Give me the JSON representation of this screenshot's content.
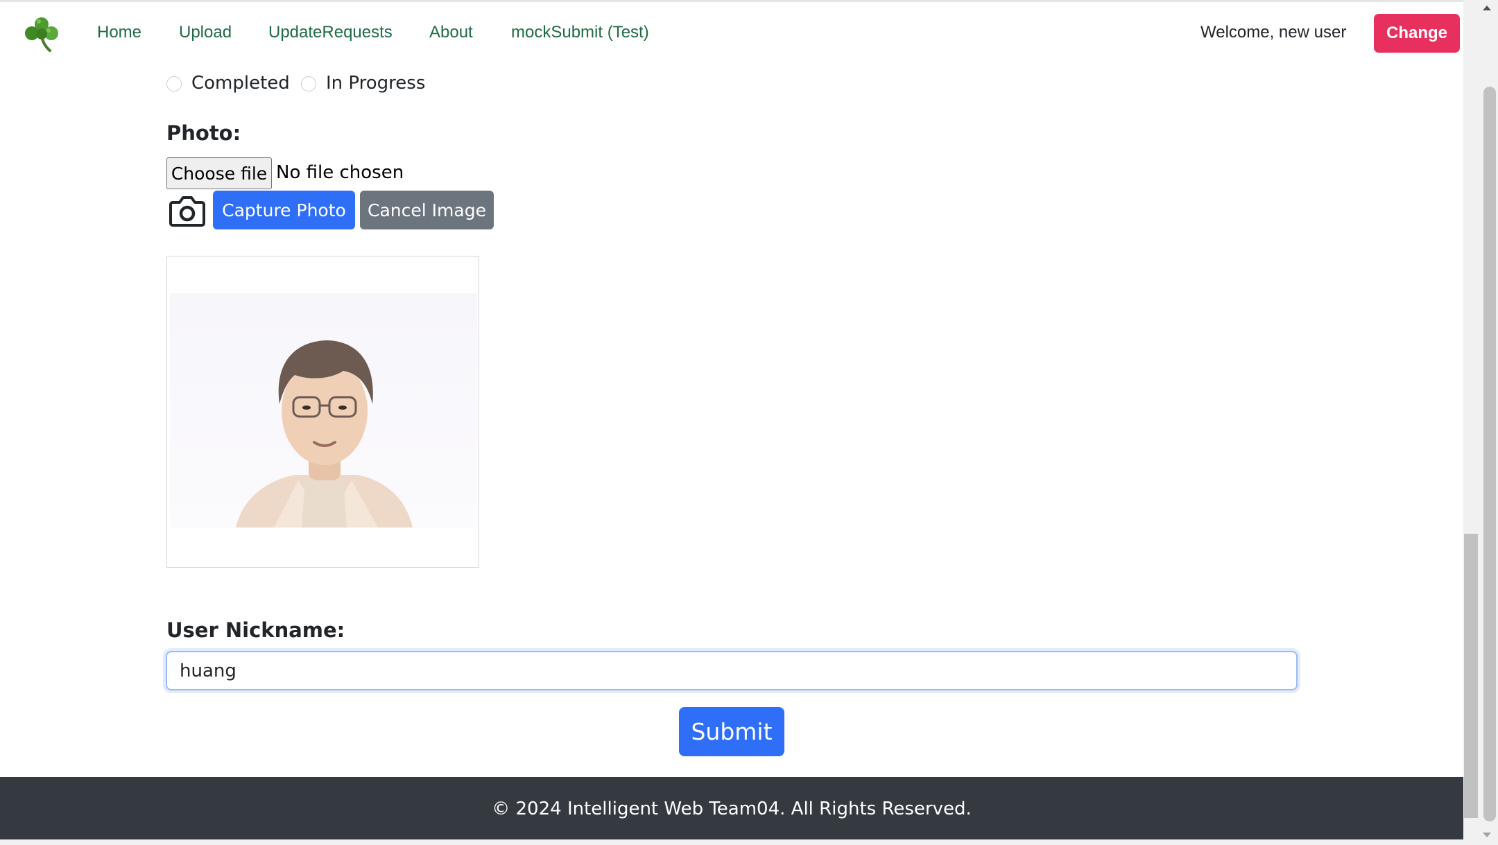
{
  "nav": {
    "logo_icon": "shamrock-icon",
    "links": [
      "Home",
      "Upload",
      "UpdateRequests",
      "About",
      "mockSubmit (Test)"
    ],
    "welcome": "Welcome, new user",
    "change_label": "Change"
  },
  "form": {
    "status_options": [
      "Completed",
      "In Progress"
    ],
    "photo_label": "Photo:",
    "file_button": "Choose file",
    "file_status": "No file chosen",
    "camera_icon": "camera-icon",
    "capture_label": "Capture Photo",
    "cancel_label": "Cancel Image",
    "nickname_label": "User Nickname:",
    "nickname_value": "huang",
    "submit_label": "Submit"
  },
  "footer": {
    "text": "© 2024 Intelligent Web Team04. All Rights Reserved."
  },
  "colors": {
    "nav_link": "#1f6b45",
    "change_button": "#e8305f",
    "primary_button": "#2f6ef7",
    "secondary_button": "#6c757d",
    "footer_bg": "#343a40"
  }
}
